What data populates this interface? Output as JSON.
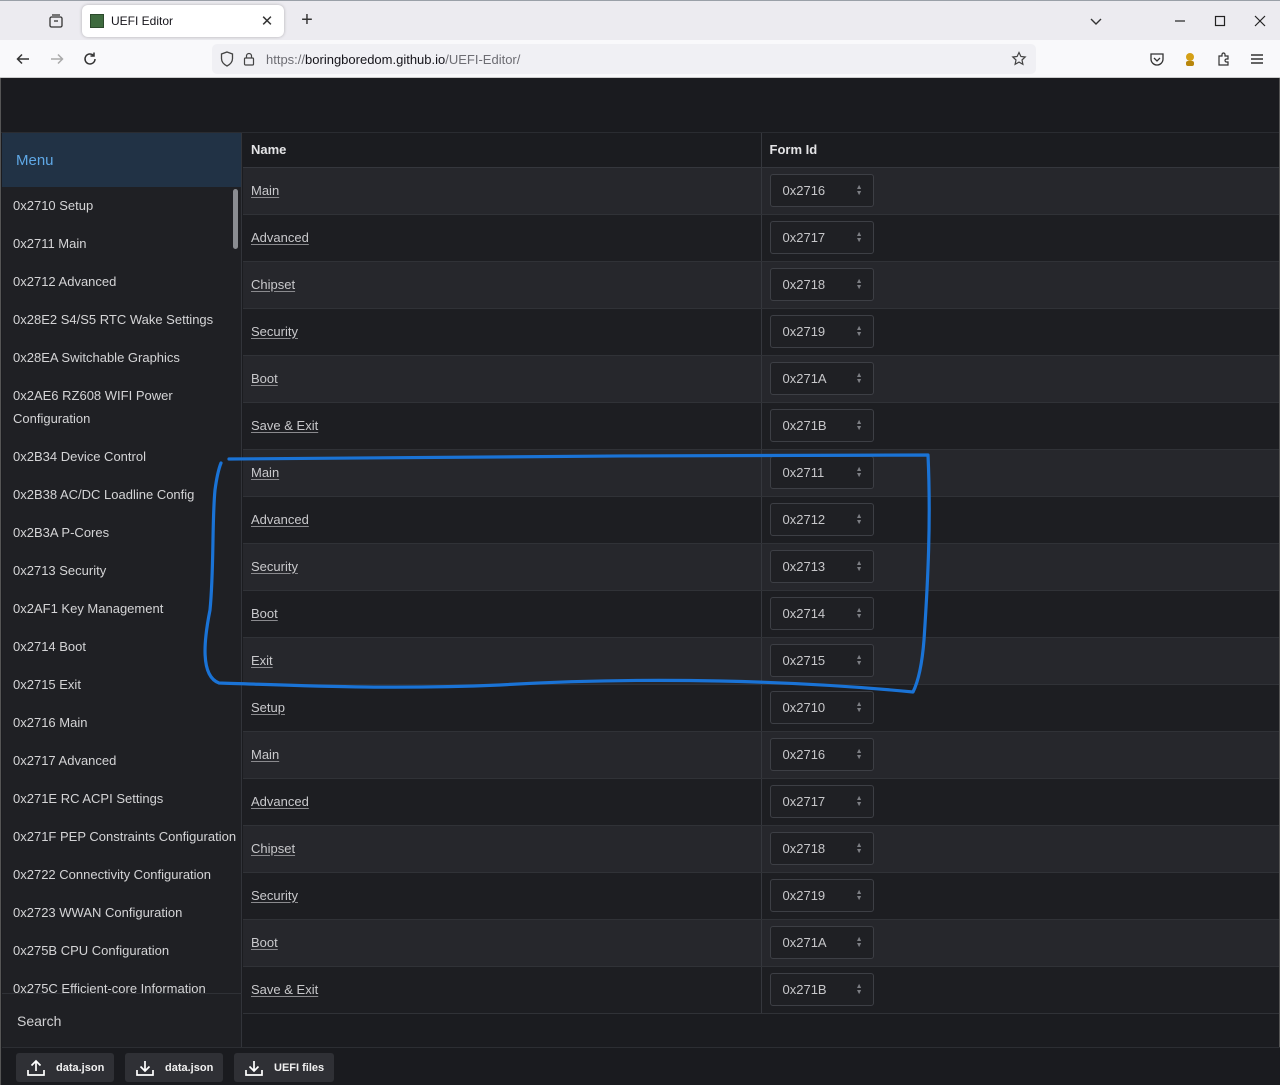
{
  "browser": {
    "tab_title": "UEFI Editor",
    "url_proto": "https://",
    "url_host": "boringboredom.github.io",
    "url_path": "/UEFI-Editor/"
  },
  "sidebar": {
    "menu_label": "Menu",
    "search_label": "Search",
    "items": [
      "0x2710 Setup",
      "0x2711 Main",
      "0x2712 Advanced",
      "0x28E2 S4/S5 RTC Wake Settings",
      "0x28EA Switchable Graphics",
      "0x2AE6 RZ608 WIFI Power Configuration",
      "0x2B34 Device Control",
      "0x2B38 AC/DC Loadline Config",
      "0x2B3A P-Cores",
      "0x2713 Security",
      "0x2AF1 Key Management",
      "0x2714 Boot",
      "0x2715 Exit",
      "0x2716 Main",
      "0x2717 Advanced",
      "0x271E RC ACPI Settings",
      "0x271F PEP Constraints Configuration",
      "0x2722 Connectivity Configuration",
      "0x2723 WWAN Configuration",
      "0x275B CPU Configuration",
      "0x275C Efficient-core Information"
    ]
  },
  "table": {
    "headers": {
      "name": "Name",
      "form_id": "Form Id"
    },
    "rows": [
      {
        "name": "Main",
        "form_id": "0x2716"
      },
      {
        "name": "Advanced",
        "form_id": "0x2717"
      },
      {
        "name": "Chipset",
        "form_id": "0x2718"
      },
      {
        "name": "Security",
        "form_id": "0x2719"
      },
      {
        "name": "Boot",
        "form_id": "0x271A"
      },
      {
        "name": "Save & Exit",
        "form_id": "0x271B"
      },
      {
        "name": "Main",
        "form_id": "0x2711"
      },
      {
        "name": "Advanced",
        "form_id": "0x2712"
      },
      {
        "name": "Security",
        "form_id": "0x2713"
      },
      {
        "name": "Boot",
        "form_id": "0x2714"
      },
      {
        "name": "Exit",
        "form_id": "0x2715"
      },
      {
        "name": "Setup",
        "form_id": "0x2710"
      },
      {
        "name": "Main",
        "form_id": "0x2716"
      },
      {
        "name": "Advanced",
        "form_id": "0x2717"
      },
      {
        "name": "Chipset",
        "form_id": "0x2718"
      },
      {
        "name": "Security",
        "form_id": "0x2719"
      },
      {
        "name": "Boot",
        "form_id": "0x271A"
      },
      {
        "name": "Save & Exit",
        "form_id": "0x271B"
      }
    ]
  },
  "bottom_bar": {
    "upload_json_label": "data.json",
    "download_json_label": "data.json",
    "download_uefi_label": "UEFI files"
  },
  "colors": {
    "annotation": "#1a73d6",
    "menu_accent": "#5fa8e6"
  }
}
